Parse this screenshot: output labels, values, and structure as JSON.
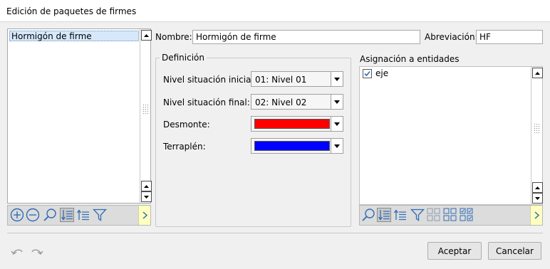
{
  "window": {
    "title": "Edición de paquetes de firmes"
  },
  "left_list": {
    "items": [
      "Hormigón de firme"
    ]
  },
  "form": {
    "nombre_label": "Nombre:",
    "nombre_value": "Hormigón de firme",
    "abreviacion_label": "Abreviación:",
    "abreviacion_value": "HF"
  },
  "definicion": {
    "legend": "Definición",
    "nivel_inicial_label": "Nivel situación inicial:",
    "nivel_inicial_value": "01: Nivel 01",
    "nivel_final_label": "Nivel situación final:",
    "nivel_final_value": "02: Nivel 02",
    "desmonte_label": "Desmonte:",
    "desmonte_color": "#ff0000",
    "terraplen_label": "Terraplén:",
    "terraplen_color": "#0000ff"
  },
  "asignacion": {
    "title": "Asignación a entidades",
    "items": [
      {
        "label": "eje",
        "checked": true
      }
    ]
  },
  "toolbar_left_icons": [
    "add-icon",
    "remove-icon",
    "search-icon",
    "sort-descending-icon",
    "sort-ascending-icon",
    "filter-icon"
  ],
  "toolbar_right_icons": [
    "search-icon",
    "sort-descending-icon",
    "sort-ascending-icon",
    "filter-icon",
    "uncheck-all-icon",
    "check-all-icon",
    "check-selected-icon"
  ],
  "footer": {
    "accept_label": "Aceptar",
    "cancel_label": "Cancelar"
  },
  "colors": {
    "accent_selection": "#d6e8fa",
    "more_button": "#ffffc0"
  }
}
